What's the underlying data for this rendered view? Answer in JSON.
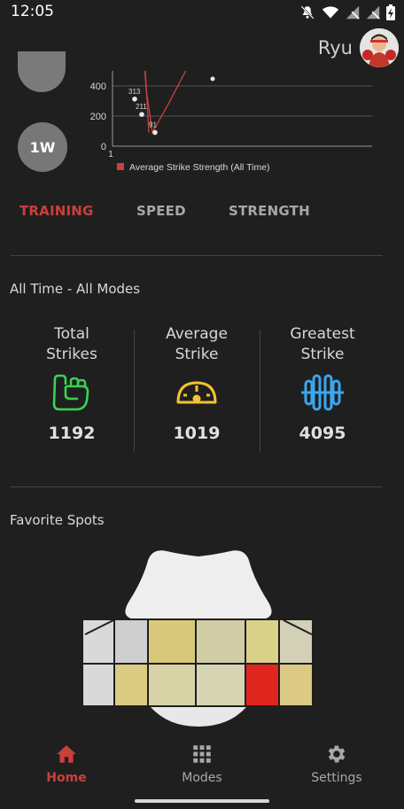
{
  "status": {
    "time": "12:05",
    "icons": [
      "mute-icon",
      "wifi-icon",
      "signal-off-icon",
      "signal-off-icon",
      "battery-charging-icon"
    ]
  },
  "user": {
    "name": "Ryu"
  },
  "period_buttons": [
    {
      "label": ""
    },
    {
      "label": "1W"
    }
  ],
  "chart_data": {
    "type": "line",
    "y_ticks": [
      "400",
      "200",
      "0"
    ],
    "x_ticks": [
      "1"
    ],
    "ylim": [
      0,
      500
    ],
    "point_labels": [
      {
        "label": "313",
        "y": 313
      },
      {
        "label": "211",
        "y": 211
      },
      {
        "label": "91",
        "y": 91
      }
    ],
    "legend": "Average Strike Strength (All Time)",
    "series_color": "#c9403c"
  },
  "tabs": [
    {
      "label": "TRAINING",
      "active": true
    },
    {
      "label": "SPEED",
      "active": false
    },
    {
      "label": "STRENGTH",
      "active": false
    }
  ],
  "summary": {
    "title": "All Time - All Modes",
    "stats": [
      {
        "line1": "Total",
        "line2": "Strikes",
        "value": "1192",
        "icon": "fist-icon",
        "color": "#39d353"
      },
      {
        "line1": "Average",
        "line2": "Strike",
        "value": "1019",
        "icon": "gauge-icon",
        "color": "#f2c230"
      },
      {
        "line1": "Greatest",
        "line2": "Strike",
        "value": "4095",
        "icon": "dumbbell-icon",
        "color": "#3aa7f0"
      }
    ]
  },
  "favorite": {
    "title": "Favorite Spots",
    "heat_row1": [
      "#d9d9d9",
      "#cfcfcf",
      "#d8c97a",
      "#d0cca6",
      "#d9d08a",
      "#d2d0b6"
    ],
    "heat_row2": [
      "#d9d9d9",
      "#dccb82",
      "#d7d3a6",
      "#d6d4b2",
      "#e0261f",
      "#dcc983"
    ]
  },
  "nav": [
    {
      "label": "Home",
      "icon": "home-icon",
      "active": true
    },
    {
      "label": "Modes",
      "icon": "grid-icon",
      "active": false
    },
    {
      "label": "Settings",
      "icon": "gear-icon",
      "active": false
    }
  ],
  "colors": {
    "accent": "#c9403c",
    "bg": "#1f1f1f",
    "inactive": "#a8a8a8"
  }
}
